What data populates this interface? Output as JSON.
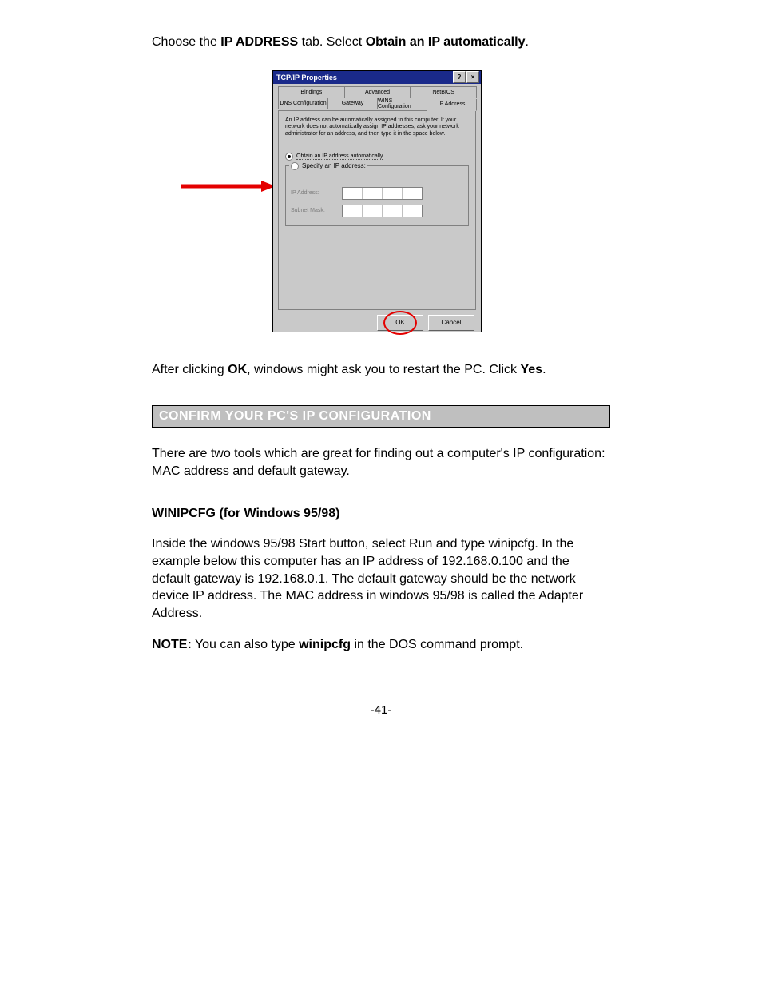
{
  "intro": {
    "pre": "Choose the ",
    "b1": "IP ADDRESS",
    "mid": " tab. Select ",
    "b2": "Obtain an IP automatically",
    "post": "."
  },
  "dialog": {
    "title": "TCP/IP Properties",
    "help_glyph": "?",
    "close_glyph": "×",
    "tabs_row1": [
      "Bindings",
      "Advanced",
      "NetBIOS"
    ],
    "tabs_row2": [
      "DNS Configuration",
      "Gateway",
      "WINS Configuration",
      "IP Address"
    ],
    "info": "An IP address can be automatically assigned to this computer. If your network does not automatically assign IP addresses, ask your network administrator for an address, and then type it in the space below.",
    "radio_auto": "Obtain an IP address automatically",
    "radio_specify": "Specify an IP address:",
    "field_ip": "IP Address:",
    "field_mask": "Subnet Mask:",
    "ok": "OK",
    "cancel": "Cancel"
  },
  "after": {
    "pre": "After clicking ",
    "b1": "OK",
    "mid": ", windows might ask you to restart the PC. Click ",
    "b2": "Yes",
    "post": "."
  },
  "section_heading": "CONFIRM YOUR PC'S IP CONFIGURATION",
  "para_tools": "There are two tools which are great for finding out a computer's IP configuration: MAC address and default gateway.",
  "sub_heading": "WINIPCFG (for Windows 95/98)",
  "para_winipcfg": "Inside the windows 95/98 Start button, select Run and type winipcfg. In the example below this computer has an IP address of 192.168.0.100 and the default gateway is 192.168.0.1. The default gateway should be the network device IP address. The MAC address in windows 95/98 is called the Adapter Address.",
  "note": {
    "b1": "NOTE:",
    "mid": " You can also type ",
    "b2": "winipcfg",
    "post": " in the DOS command prompt."
  },
  "page_number": "-41-"
}
